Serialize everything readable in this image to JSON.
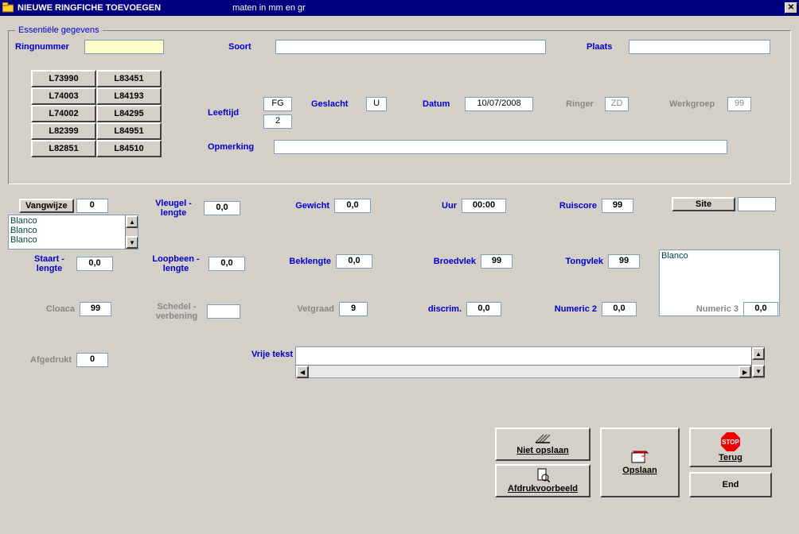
{
  "window": {
    "title": "NIEUWE RINGFICHE TOEVOEGEN",
    "subtitle": "maten in mm en gr"
  },
  "essentials": {
    "legend": "Essentiële gegevens",
    "ringnummer_label": "Ringnummer",
    "ringnummer_value": "",
    "soort_label": "Soort",
    "soort_value": "",
    "plaats_label": "Plaats",
    "plaats_value": "",
    "leeftijd_label": "Leeftijd",
    "leeftijd_code": "FG",
    "leeftijd_num": "2",
    "geslacht_label": "Geslacht",
    "geslacht_value": "U",
    "datum_label": "Datum",
    "datum_value": "10/07/2008",
    "ringer_label": "Ringer",
    "ringer_value": "ZD",
    "werkgroep_label": "Werkgroep",
    "werkgroep_value": "99",
    "opmerking_label": "Opmerking",
    "opmerking_value": "",
    "ring_grid": [
      [
        "L73990",
        "L83451"
      ],
      [
        "L74003",
        "L84193"
      ],
      [
        "L74002",
        "L84295"
      ],
      [
        "L82399",
        "L84951"
      ],
      [
        "L82851",
        "L84510"
      ]
    ]
  },
  "measure": {
    "vangwijze_label": "Vangwijze",
    "vangwijze_value": "0",
    "vangwijze_options": [
      "Blanco",
      "Blanco",
      "Blanco"
    ],
    "vleugel_label": "Vleugel - lengte",
    "vleugel_value": "0,0",
    "gewicht_label": "Gewicht",
    "gewicht_value": "0,0",
    "uur_label": "Uur",
    "uur_value": "00:00",
    "ruiscore_label": "Ruiscore",
    "ruiscore_value": "99",
    "site_label": "Site",
    "site_value": "",
    "site_options": [
      "Blanco"
    ],
    "staart_label": "Staart - lengte",
    "staart_value": "0,0",
    "loopbeen_label": "Loopbeen - lengte",
    "loopbeen_value": "0,0",
    "beklengte_label": "Beklengte",
    "beklengte_value": "0,0",
    "broedvlek_label": "Broedvlek",
    "broedvlek_value": "99",
    "tongvlek_label": "Tongvlek",
    "tongvlek_value": "99",
    "cloaca_label": "Cloaca",
    "cloaca_value": "99",
    "schedel_label": "Schedel - verbening",
    "schedel_value": "",
    "vetgraad_label": "Vetgraad",
    "vetgraad_value": "9",
    "discrim_label": "discrim.",
    "discrim_value": "0,0",
    "numeric2_label": "Numeric 2",
    "numeric2_value": "0,0",
    "numeric3_label": "Numeric 3",
    "numeric3_value": "0,0",
    "afgedrukt_label": "Afgedrukt",
    "afgedrukt_value": "0",
    "vrijetekst_label": "Vrije tekst",
    "vrijetekst_value": ""
  },
  "buttons": {
    "niet_opslaan": "Niet opslaan",
    "afdrukvoorbeeld": "Afdrukvoorbeeld",
    "opslaan": "Opslaan",
    "terug": "Terug",
    "stop": "STOP",
    "end": "End"
  }
}
